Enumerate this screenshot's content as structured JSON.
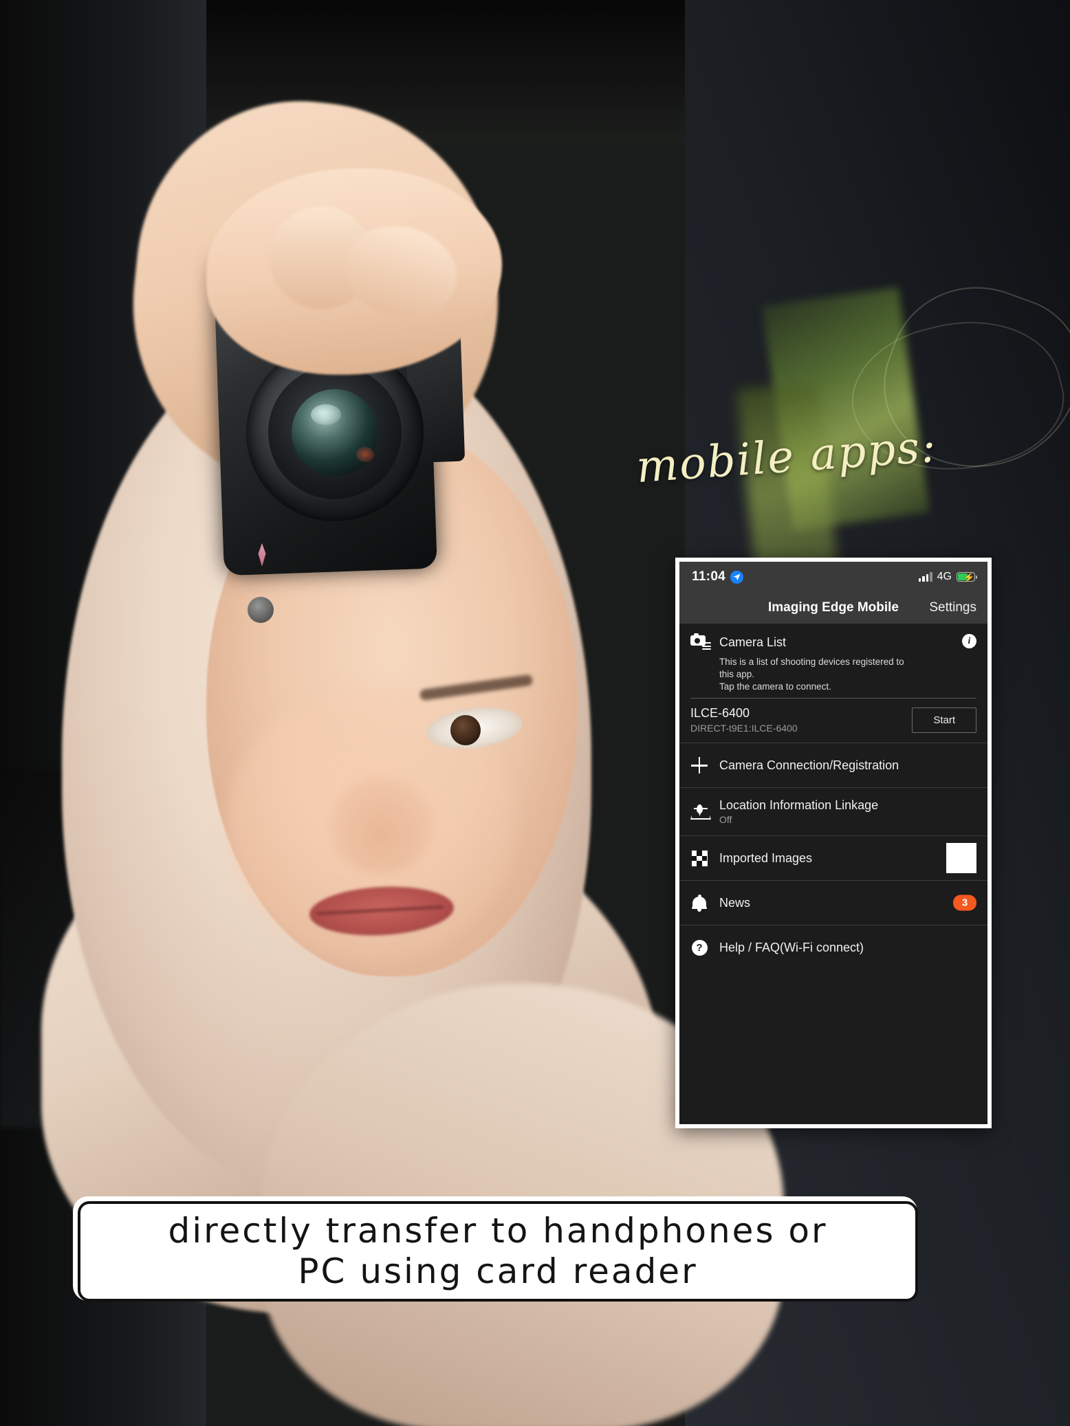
{
  "overlay": {
    "script_text": "mobile apps:"
  },
  "phone": {
    "statusbar": {
      "time": "11:04",
      "location_icon": "location-arrow-icon",
      "signal_icon": "cellular-signal-icon",
      "network": "4G",
      "battery_icon": "battery-charging-icon"
    },
    "navbar": {
      "title": "Imaging Edge Mobile",
      "settings_label": "Settings"
    },
    "camera_list": {
      "icon": "camera-list-icon",
      "title": "Camera List",
      "info_icon": "info-icon",
      "description": "This is a list of shooting devices registered to this app.\nTap the camera to connect.",
      "description_line1": "This is a list of shooting devices registered to",
      "description_line2": "this app.",
      "description_line3": "Tap the camera to connect.",
      "device": {
        "model": "ILCE-6400",
        "ssid": "DIRECT-t9E1:ILCE-6400",
        "action_label": "Start"
      }
    },
    "menu_items": [
      {
        "icon": "plus-icon",
        "label": "Camera Connection/Registration",
        "sub": "",
        "accessory": "none"
      },
      {
        "icon": "location-linkage-icon",
        "label": "Location Information Linkage",
        "sub": "Off",
        "accessory": "none"
      },
      {
        "icon": "checkerboard-icon",
        "label": "Imported Images",
        "sub": "",
        "accessory": "thumbnail"
      },
      {
        "icon": "bell-icon",
        "label": "News",
        "sub": "",
        "accessory": "badge",
        "badge": "3"
      },
      {
        "icon": "question-mark-icon",
        "label": "Help / FAQ(Wi-Fi connect)",
        "sub": "",
        "accessory": "none"
      }
    ]
  },
  "caption": {
    "line1": "directly transfer to handphones or",
    "line2": "PC using card reader"
  },
  "colors": {
    "accent_orange": "#f4591f",
    "panel_bg": "#1c1c1c",
    "bar_bg": "#3a3a3a",
    "script_cream": "#f4efc2",
    "battery_green": "#2ecc55",
    "location_blue": "#1a82fb"
  }
}
